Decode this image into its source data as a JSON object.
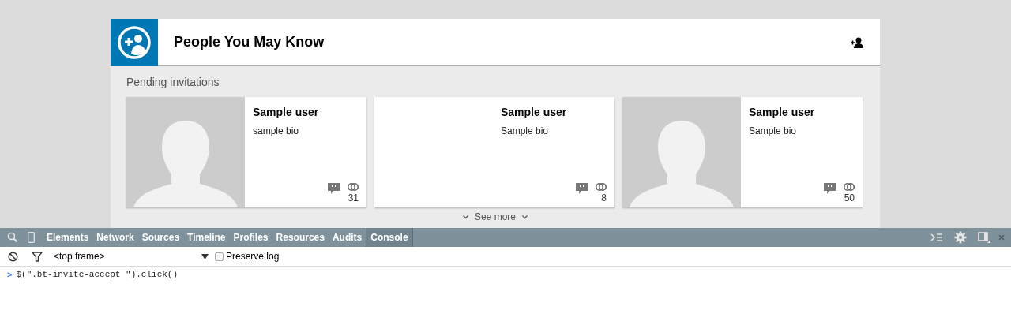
{
  "widget": {
    "title": "People You May Know",
    "section_label": "Pending invitations",
    "see_more": "See more"
  },
  "cards": [
    {
      "name": "Sample user",
      "bio": "sample bio",
      "has_photo": true,
      "count": "31"
    },
    {
      "name": "Sample user",
      "bio": "Sample bio",
      "has_photo": false,
      "count": "8"
    },
    {
      "name": "Sample user",
      "bio": "Sample bio",
      "has_photo": true,
      "count": "50"
    }
  ],
  "devtools": {
    "tabs": [
      {
        "label": "Elements",
        "selected": false
      },
      {
        "label": "Network",
        "selected": false
      },
      {
        "label": "Sources",
        "selected": false
      },
      {
        "label": "Timeline",
        "selected": false
      },
      {
        "label": "Profiles",
        "selected": false
      },
      {
        "label": "Resources",
        "selected": false
      },
      {
        "label": "Audits",
        "selected": false
      },
      {
        "label": "Console",
        "selected": true
      }
    ],
    "frame_select": "<top frame>",
    "preserve_log": {
      "label": "Preserve log",
      "checked": false
    },
    "console_lines": [
      {
        "prompt": ">",
        "code": "$(\".bt-invite-accept \").click()"
      }
    ]
  }
}
